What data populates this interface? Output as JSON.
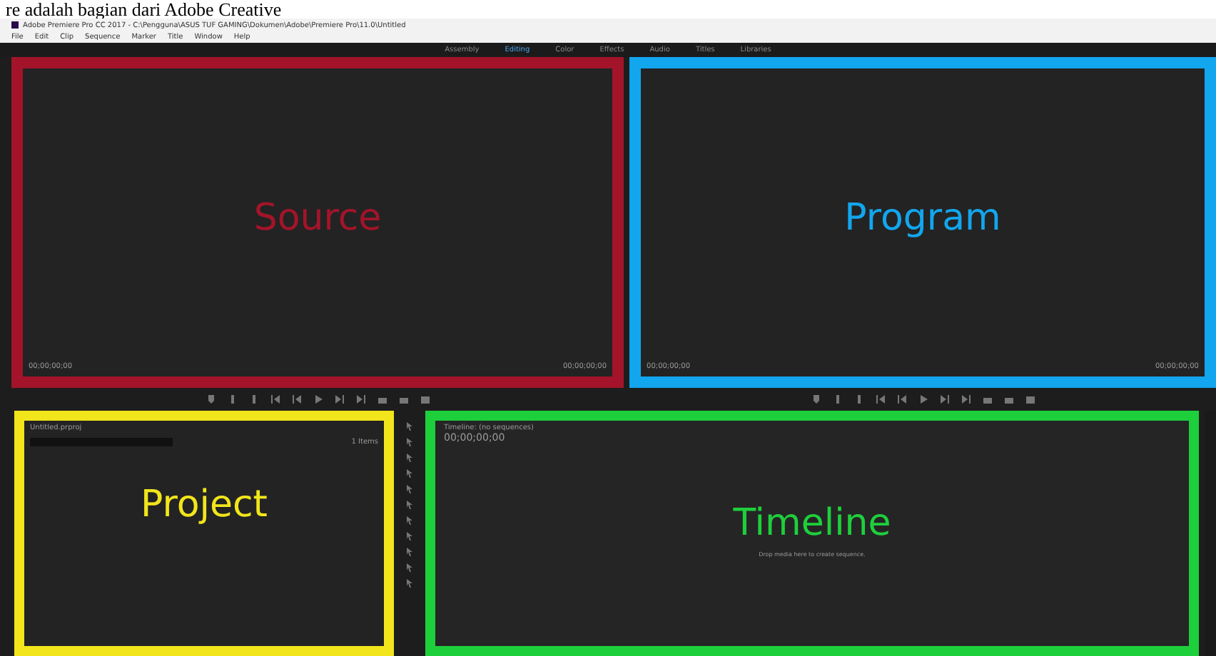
{
  "caption": "re adalah bagian dari Adobe Creative",
  "window": {
    "title": "Adobe Premiere Pro CC 2017 - C:\\Pengguna\\ASUS TUF GAMING\\Dokumen\\Adobe\\Premiere Pro\\11.0\\Untitled"
  },
  "menu": [
    "File",
    "Edit",
    "Clip",
    "Sequence",
    "Marker",
    "Title",
    "Window",
    "Help"
  ],
  "workspaces": [
    {
      "label": "Assembly",
      "selected": false
    },
    {
      "label": "Editing",
      "selected": true
    },
    {
      "label": "Color",
      "selected": false
    },
    {
      "label": "Effects",
      "selected": false
    },
    {
      "label": "Audio",
      "selected": false
    },
    {
      "label": "Titles",
      "selected": false
    },
    {
      "label": "Libraries",
      "selected": false
    }
  ],
  "source": {
    "annotation": "Source",
    "color": "#a3142a",
    "timecode_left": "00;00;00;00",
    "timecode_right": "00;00;00;00"
  },
  "program": {
    "annotation": "Program",
    "color": "#12a6ee",
    "timecode_left": "00;00;00;00",
    "timecode_right": "00;00;00;00"
  },
  "project": {
    "annotation": "Project",
    "color": "#f2e51b",
    "file": "Untitled.prproj",
    "items": "1 Items"
  },
  "timeline": {
    "annotation": "Timeline",
    "color": "#1ecf3c",
    "tab": "Timeline: (no sequences)",
    "timecode": "00;00;00;00",
    "hint": "Drop media here to create sequence."
  }
}
